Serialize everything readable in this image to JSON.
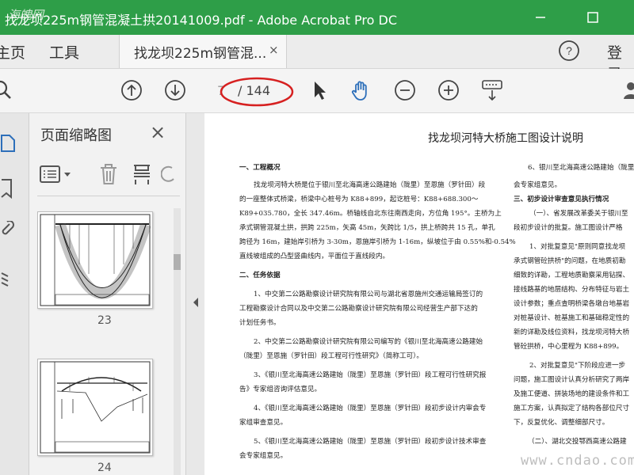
{
  "window": {
    "title": "找龙坝225m钢管混凝土拱20141009.pdf - Adobe Acrobat Pro DC",
    "logo_text": "海魄网"
  },
  "menu": {
    "home": "主页",
    "tools": "工具",
    "signin": "登录"
  },
  "tab": {
    "label": "找龙坝225m钢管混...",
    "close": "×"
  },
  "toolbar": {
    "page_current": "7",
    "page_total": "/ 144"
  },
  "thumbnails": {
    "title": "页面缩略图",
    "close": "×",
    "pages": [
      {
        "number": "23"
      },
      {
        "number": "24"
      }
    ]
  },
  "document": {
    "title": "找龙坝河特大桥施工图设计说明",
    "left_column": [
      {
        "text": "一、工程概况",
        "heading": true
      },
      {
        "text": "找龙坝河特大桥是位于银川至北海高速公路建始（陇里）至恩施（罗针田）段"
      },
      {
        "text": "的一座整体式桥梁，桥梁中心桩号为 K88+899，起讫桩号：K88+688.300～"
      },
      {
        "text": "K89+035.780，全长 347.46m。桥轴线自北东往南西走向，方位角 195°。主桥为上"
      },
      {
        "text": "承式钢管混凝土拱，拱跨 225m，矢高 45m，矢跨比 1/5，拱上桥跨共 15 孔，单孔"
      },
      {
        "text": "跨径为 16m，建始岸引桥为 3-30m，恩施岸引桥为 1-16m，纵坡位于由 0.55%和-0.54%"
      },
      {
        "text": "直线坡组成的凸型竖曲线内，平面位于直线段内。"
      },
      {
        "text": "二、任务依据",
        "heading": true
      },
      {
        "text": "1、中交第二公路勘察设计研究院有限公司与湖北省恩施州交通运输局签订的"
      },
      {
        "text": "工程勘察设计合同以及中交第二公路勘察设计研究院有限公司经营生产部下达的"
      },
      {
        "text": "计划任务书。"
      },
      {
        "text": "2、中交第二公路勘察设计研究院有限公司编写的《银川至北海高速公路建始"
      },
      {
        "text": "（陇里）至恩施（罗针田）段工程可行性研究》（简称工可）。"
      },
      {
        "text": "3、《银川至北海高速公路建始（陇里）至恩施（罗针田）段工程可行性研究报"
      },
      {
        "text": "告》专家组咨询评估意见。"
      },
      {
        "text": "4、《银川至北海高速公路建始（陇里）至恩施（罗针田）段初步设计内审会专"
      },
      {
        "text": "家组审查意见。"
      },
      {
        "text": "5、《银川至北海高速公路建始（陇里）至恩施（罗针田）段初步设计技术审查"
      },
      {
        "text": "会专家组意见。"
      }
    ],
    "right_column": [
      {
        "text": "6、银川至北海高速公路建始（陇里"
      },
      {
        "text": "会专家组意见。"
      },
      {
        "text": "三、初步设计审查意见执行情况",
        "heading": true
      },
      {
        "text": "（一）、省发展改革委关于银川至"
      },
      {
        "text": "段初步设计的批复。施工图设计严格"
      },
      {
        "text": "1、对批复意见\"原则同意找龙坝"
      },
      {
        "text": "承式钢管砼拱桥\"的问题，在地质初勘"
      },
      {
        "text": "细致的详勘，工程地质勘察采用钻探、"
      },
      {
        "text": "接线路基的地层结构、分布特征与岩土"
      },
      {
        "text": "设计参数；重点查明桥梁各墩台地基岩"
      },
      {
        "text": "对桩基设计、桩基施工和基础稳定性的"
      },
      {
        "text": "新的详勘及线位资料，找龙坝河特大桥"
      },
      {
        "text": "管砼拱桥，中心里程为 K88+899。"
      },
      {
        "text": "2、对批复意见\"下阶段应进一步"
      },
      {
        "text": "问题，施工图设计认真分析研究了两岸"
      },
      {
        "text": "及施工便道、拼装场地的建设条件和工"
      },
      {
        "text": "施工方案，认真拟定了结构各部位尺寸"
      },
      {
        "text": "下，反复优化、调整细部尺寸。"
      },
      {
        "text": "（二）、湖北交投鄂西高速公路建"
      }
    ]
  },
  "watermark": "www.cndao.com",
  "colors": {
    "titlebar": "#2e9e48",
    "accent_blue": "#2d6fba",
    "annotation_red": "#d62020"
  }
}
